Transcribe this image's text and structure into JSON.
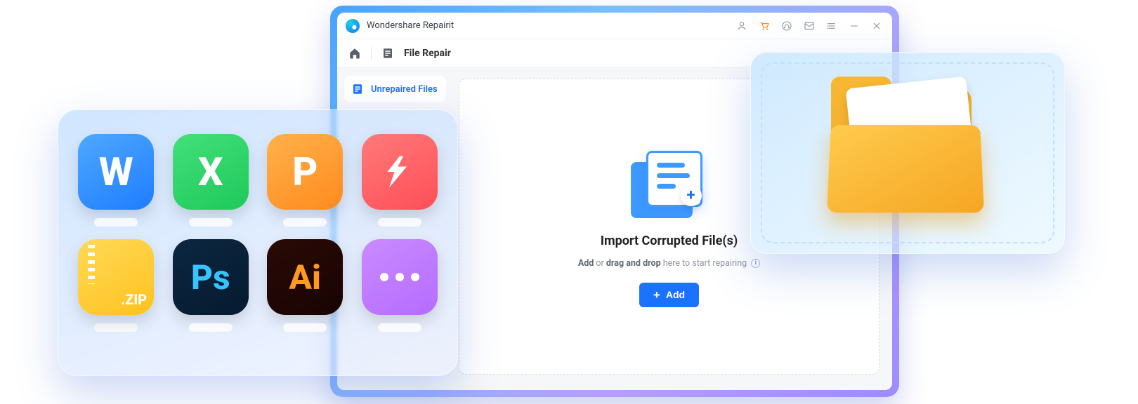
{
  "window": {
    "title": "Wondershare Repairit",
    "toolbar_title": "File Repair"
  },
  "sidebar": {
    "items": [
      {
        "label": "Unrepaired Files"
      }
    ]
  },
  "dropzone": {
    "title": "Import Corrupted File(s)",
    "sub_prefix": "Add",
    "sub_mid": " or ",
    "sub_bold": "drag and drop",
    "sub_suffix": " here to start repairing",
    "add_button": "Add"
  },
  "icon_grid": {
    "tiles": [
      {
        "id": "word",
        "glyph": "W"
      },
      {
        "id": "excel",
        "glyph": "X"
      },
      {
        "id": "ppt",
        "glyph": "P"
      },
      {
        "id": "pdf",
        "glyph": ""
      },
      {
        "id": "zip",
        "glyph": ".ZIP"
      },
      {
        "id": "ps",
        "glyph": "Ps"
      },
      {
        "id": "ai",
        "glyph": "Ai"
      },
      {
        "id": "more",
        "glyph": ""
      }
    ]
  },
  "titlebar_icons": [
    "user",
    "cart",
    "support",
    "mail",
    "menu",
    "minimize",
    "close"
  ]
}
